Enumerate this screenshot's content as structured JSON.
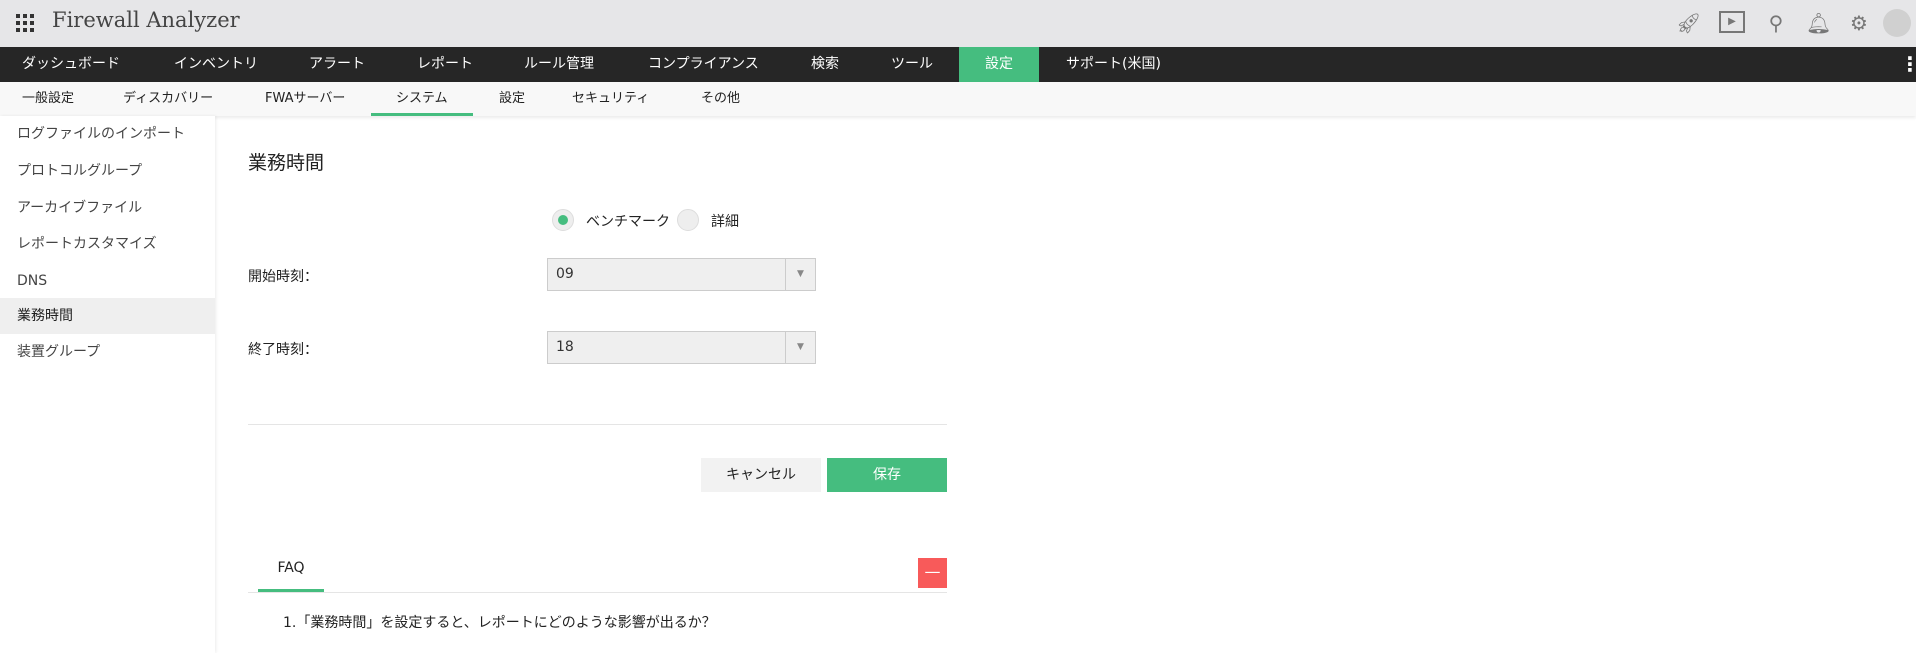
{
  "app": {
    "title": "Firewall Analyzer"
  },
  "topicons": [
    "rocket-icon",
    "presentation-icon",
    "search-icon",
    "bell-icon",
    "gear-icon",
    "avatar-icon"
  ],
  "nav": [
    "ダッシュボード",
    "インベントリ",
    "アラート",
    "レポート",
    "ルール管理",
    "コンプライアンス",
    "検索",
    "ツール",
    "設定",
    "サポート(米国)"
  ],
  "subnav": [
    "一般設定",
    "ディスカバリー",
    "FWAサーバー",
    "システム",
    "設定",
    "セキュリティ",
    "その他"
  ],
  "sidebar": [
    "ログファイルのインポート",
    "プロトコルグループ",
    "アーカイブファイル",
    "レポートカスタマイズ",
    "DNS",
    "業務時間",
    "装置グループ"
  ],
  "main": {
    "title": "業務時間",
    "radio_benchmark": "ベンチマーク",
    "radio_detail": "詳細",
    "start_label": "開始時刻：",
    "start_value": "09",
    "end_label": "終了時刻：",
    "end_value": "18",
    "cancel": "キャンセル",
    "save": "保存"
  },
  "faq": {
    "tab": "FAQ",
    "collapse": "—",
    "q1": "1.「業務時間」を設定すると、レポートにどのような影響が出るか？"
  },
  "colors": {
    "accent": "#45bd7f",
    "danger": "#f85a5a",
    "nav_bg": "#262626"
  }
}
